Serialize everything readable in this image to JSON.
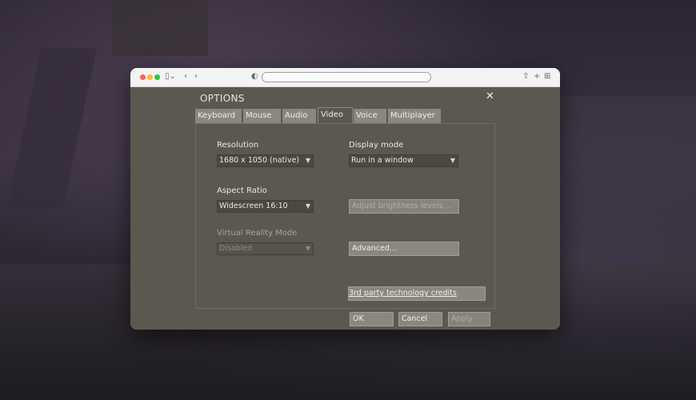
{
  "dialog": {
    "title": "OPTIONS",
    "close_glyph": "✕",
    "tabs": [
      {
        "label": "Keyboard",
        "active": false
      },
      {
        "label": "Mouse",
        "active": false
      },
      {
        "label": "Audio",
        "active": false
      },
      {
        "label": "Video",
        "active": true
      },
      {
        "label": "Voice",
        "active": false
      },
      {
        "label": "Multiplayer",
        "active": false
      }
    ],
    "video": {
      "resolution_label": "Resolution",
      "resolution_value": "1680 x 1050 (native)",
      "display_mode_label": "Display mode",
      "display_mode_value": "Run in a window",
      "aspect_ratio_label": "Aspect Ratio",
      "aspect_ratio_value": "Widescreen 16:10",
      "brightness_button": "Adjust brightness levels...",
      "vr_mode_label": "Virtual Reality Mode",
      "vr_mode_value": "Disabled",
      "advanced_button": "Advanced...",
      "credits_button": "3rd party technology credits"
    },
    "footer": {
      "ok": "OK",
      "cancel": "Cancel",
      "apply": "Apply"
    }
  },
  "browser": {
    "icons": [
      "sidebar-icon",
      "back-icon",
      "forward-icon",
      "shield-icon",
      "share-icon",
      "new-tab-icon",
      "tab-overview-icon"
    ]
  },
  "colors": {
    "dialog_bg": "#5b5850",
    "tab_bg": "#8a8780",
    "text": "#ece8dc"
  }
}
